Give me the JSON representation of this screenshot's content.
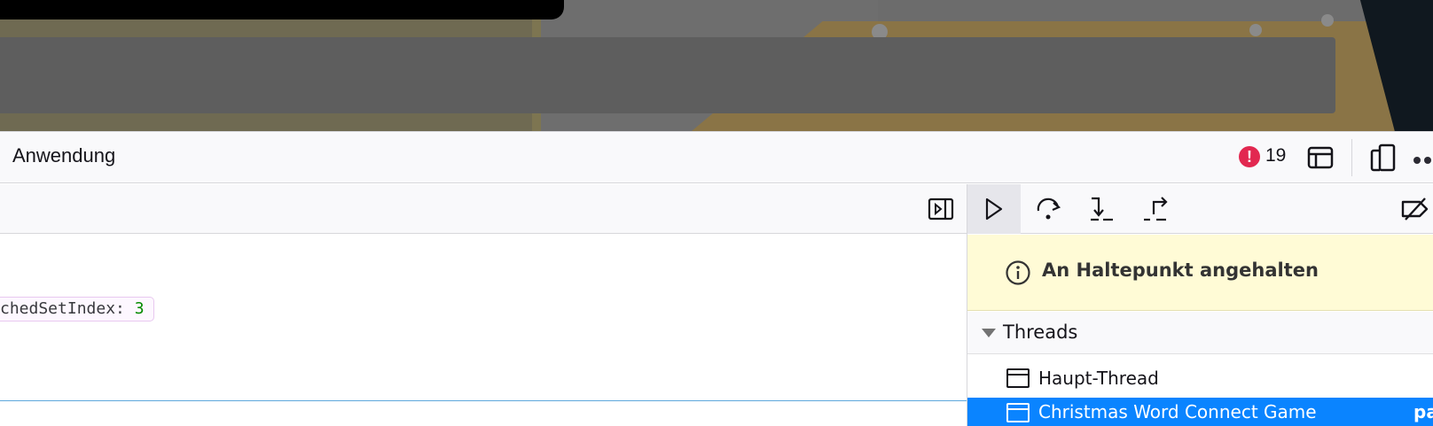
{
  "toolbox": {
    "active_tab": "Anwendung",
    "error_count": "19"
  },
  "editor": {
    "preview_key": "chedSetIndex: ",
    "preview_value": "3"
  },
  "debugger": {
    "paused_message": "An Haltepunkt angehalten",
    "threads_title": "Threads",
    "threads": [
      {
        "label": "Haupt-Thread",
        "selected": false
      },
      {
        "label": "Christmas Word Connect Game",
        "selected": true,
        "tail": "pa"
      }
    ]
  },
  "icons": {
    "error": "error-icon",
    "dock": "dock-layout-icon",
    "responsive": "responsive-design-icon",
    "overflow": "overflow-menu-icon",
    "sidebar_toggle": "toggle-sidebar-icon",
    "resume": "resume-icon",
    "step_over": "step-over-icon",
    "step_in": "step-in-icon",
    "step_out": "step-out-icon",
    "deactivate_breakpoints": "deactivate-breakpoints-icon",
    "info": "info-icon",
    "thread": "window-icon"
  },
  "colors": {
    "error_badge": "#e22850",
    "paused_banner_bg": "#fffbd6",
    "selected_row": "#0a84ff",
    "number_literal": "#058b00"
  }
}
